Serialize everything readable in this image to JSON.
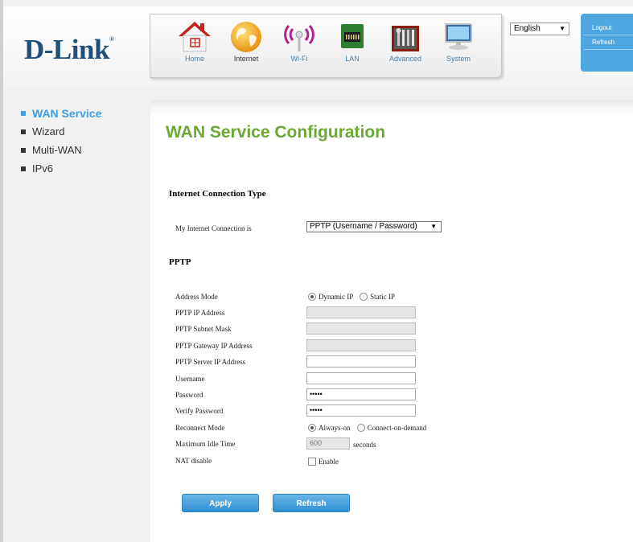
{
  "brand": {
    "logo_text": "D-Link",
    "registered_mark": "®"
  },
  "nav": {
    "items": [
      {
        "label": "Home",
        "icon": "house-icon"
      },
      {
        "label": "Internet",
        "icon": "globe-icon"
      },
      {
        "label": "Wi-Fi",
        "icon": "wifi-antenna-icon"
      },
      {
        "label": "LAN",
        "icon": "lan-chip-icon"
      },
      {
        "label": "Advanced",
        "icon": "toolbox-icon"
      },
      {
        "label": "System",
        "icon": "monitor-icon"
      }
    ],
    "active": "Internet"
  },
  "language": {
    "selected": "English",
    "arrow": "▼"
  },
  "top_links": {
    "logout": "Logout",
    "refresh": "Refresh"
  },
  "sidebar": {
    "items": [
      {
        "label": "WAN Service",
        "active": true
      },
      {
        "label": "Wizard",
        "active": false
      },
      {
        "label": "Multi-WAN",
        "active": false
      },
      {
        "label": "IPv6",
        "active": false
      }
    ]
  },
  "page": {
    "title": "WAN Service Configuration"
  },
  "connection": {
    "section_title": "Internet Connection Type",
    "label": "My Internet Connection is",
    "selected": "PPTP (Username / Password)",
    "arrow": "▼"
  },
  "pptp": {
    "section_title": "PPTP",
    "address_mode": {
      "label": "Address Mode",
      "option_dynamic": "Dynamic IP",
      "option_static": "Static IP",
      "selected": "Dynamic IP"
    },
    "ip_address": {
      "label": "PPTP IP Address",
      "value": ""
    },
    "subnet_mask": {
      "label": "PPTP Subnet Mask",
      "value": ""
    },
    "gateway": {
      "label": "PPTP Gateway IP Address",
      "value": ""
    },
    "server_ip": {
      "label": "PPTP Server IP Address",
      "value": ""
    },
    "username": {
      "label": "Username",
      "value": ""
    },
    "password": {
      "label": "Password",
      "value": "•••••"
    },
    "verify_password": {
      "label": "Verify Password",
      "value": "•••••"
    },
    "reconnect_mode": {
      "label": "Reconnect Mode",
      "option_always": "Always-on",
      "option_demand": "Connect-on-demand",
      "selected": "Always-on"
    },
    "max_idle": {
      "label": "Maximum Idle Time",
      "value": "600",
      "unit": "seconds"
    },
    "nat_disable": {
      "label": "NAT disable",
      "option": "Enable",
      "checked": false
    }
  },
  "buttons": {
    "apply": "Apply",
    "refresh": "Refresh"
  },
  "colors": {
    "title_green": "#69a832",
    "accent_blue": "#3f9fe0",
    "button_blue": "#2f8fd3",
    "logo_blue": "#1f4f7a"
  }
}
